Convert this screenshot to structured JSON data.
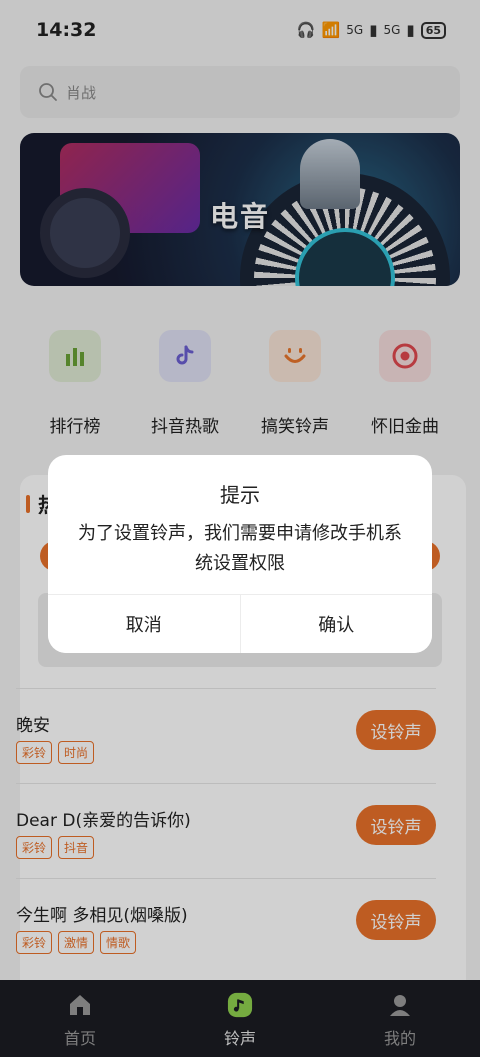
{
  "status_bar": {
    "time": "14:32",
    "network_1": "5G",
    "network_2": "5G",
    "battery": "65"
  },
  "search": {
    "placeholder": "肖战"
  },
  "banner": {
    "title": "电音"
  },
  "categories": [
    {
      "label": "排行榜",
      "icon": "bar-chart-icon",
      "bg": "#dfe9d3",
      "color": "#6aa236"
    },
    {
      "label": "抖音热歌",
      "icon": "tiktok-icon",
      "bg": "#dfe0f3",
      "color": "#6b5fd1"
    },
    {
      "label": "搞笑铃声",
      "icon": "smile-icon",
      "bg": "#f7e3d6",
      "color": "#e8762c"
    },
    {
      "label": "怀旧金曲",
      "icon": "target-icon",
      "bg": "#f5dcdc",
      "color": "#e0494f"
    }
  ],
  "panel": {
    "title": "热"
  },
  "songs": [
    {
      "title": "晚安",
      "tags": [
        "彩铃",
        "时尚"
      ],
      "button": "设铃声"
    },
    {
      "title": "Dear D(亲爱的告诉你)",
      "tags": [
        "彩铃",
        "抖音"
      ],
      "button": "设铃声"
    },
    {
      "title": "今生啊 多相见(烟嗓版)",
      "tags": [
        "彩铃",
        "激情",
        "情歌"
      ],
      "button": "设铃声"
    }
  ],
  "tabbar": {
    "tabs": [
      {
        "label": "首页",
        "icon": "home-icon"
      },
      {
        "label": "铃声",
        "icon": "ringtone-icon"
      },
      {
        "label": "我的",
        "icon": "profile-icon"
      }
    ],
    "active": "铃声"
  },
  "dialog": {
    "title": "提示",
    "message": "为了设置铃声，我们需要申请修改手机系统设置权限",
    "cancel": "取消",
    "confirm": "确认"
  },
  "colors": {
    "accent": "#e8712a",
    "tabbar_bg": "#1b1d23"
  }
}
